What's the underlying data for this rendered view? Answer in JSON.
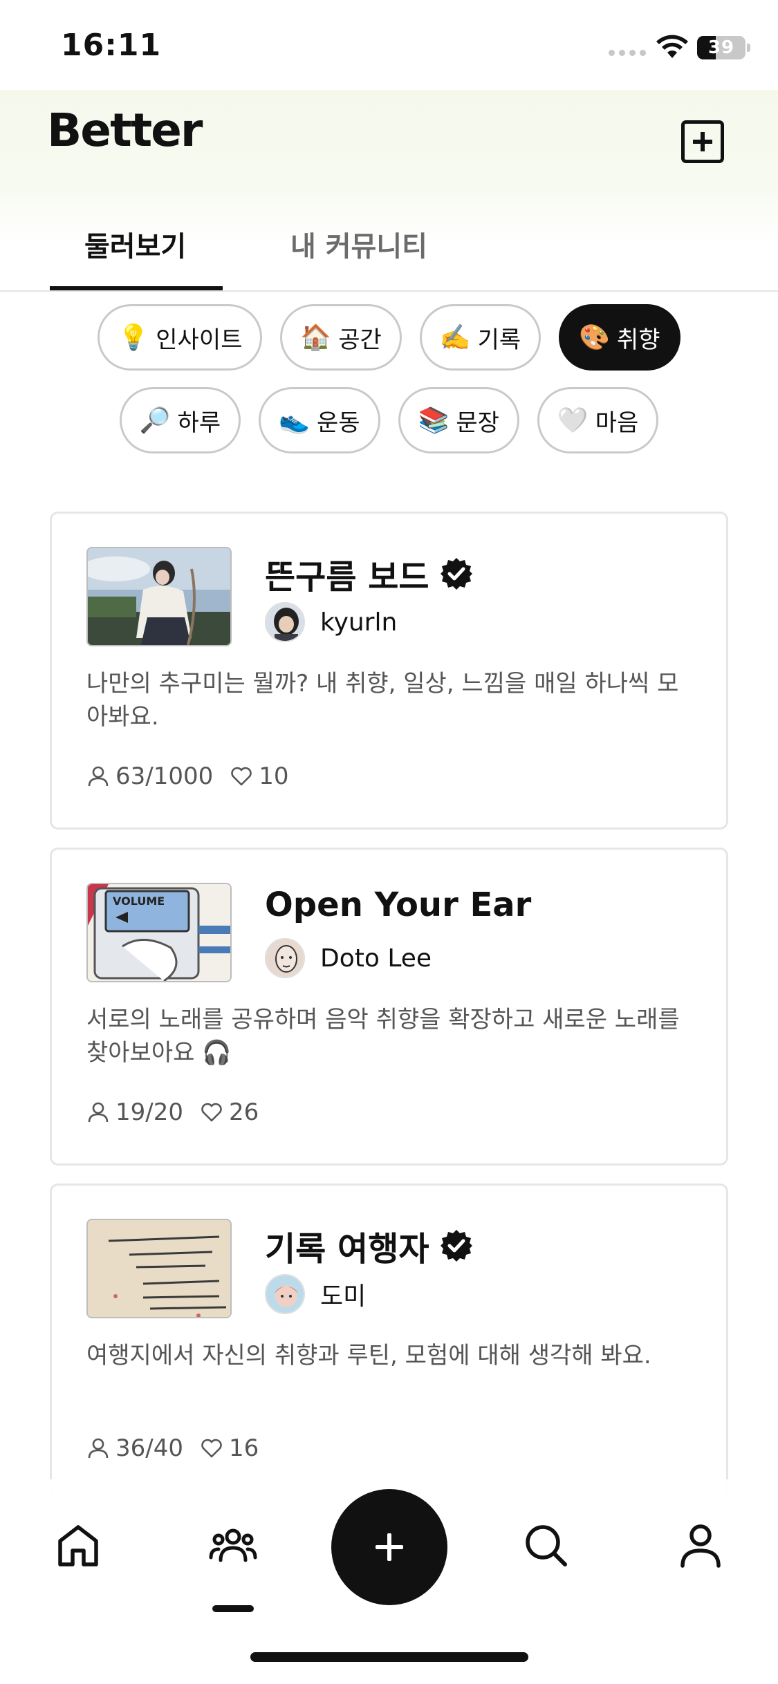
{
  "status_bar": {
    "time": "16:11",
    "battery_level": "39",
    "battery_fraction": 0.39
  },
  "header": {
    "logo": "Better",
    "add_button_icon": "plus-square-icon"
  },
  "tabs": [
    {
      "label": "둘러보기",
      "active": true
    },
    {
      "label": "내 커뮤니티",
      "active": false
    }
  ],
  "categories_row1": [
    {
      "emoji": "💡",
      "label": "인사이트",
      "selected": false
    },
    {
      "emoji": "🏠",
      "label": "공간",
      "selected": false
    },
    {
      "emoji": "✍️",
      "label": "기록",
      "selected": false
    },
    {
      "emoji": "🎨",
      "label": "취향",
      "selected": true
    }
  ],
  "categories_row2": [
    {
      "emoji": "🔎",
      "label": "하루",
      "selected": false
    },
    {
      "emoji": "👟",
      "label": "운동",
      "selected": false
    },
    {
      "emoji": "📚",
      "label": "문장",
      "selected": false
    },
    {
      "emoji": "🤍",
      "label": "마음",
      "selected": false
    }
  ],
  "communities": [
    {
      "title": "뜬구름 보드",
      "verified": true,
      "author": "kyurln",
      "description": "나만의 추구미는 뭘까? 내 취향, 일상, 느낌을 매일 하나씩 모아봐요.",
      "members": "63/1000",
      "likes": "10"
    },
    {
      "title": "Open Your Ear",
      "verified": false,
      "author": "Doto Lee",
      "description": "서로의 노래를 공유하며 음악 취향을 확장하고 새로운 노래를 찾아보아요 🎧",
      "members": "19/20",
      "likes": "26"
    },
    {
      "title": "기록 여행자",
      "verified": true,
      "author": "도미",
      "description": "여행지에서 자신의 취향과 루틴, 모험에 대해 생각해 봐요.",
      "members": "36/40",
      "likes": "16"
    }
  ],
  "bottom_nav": {
    "items": [
      "home-icon",
      "community-icon",
      "create-icon",
      "search-icon",
      "profile-icon"
    ],
    "active": "community-icon"
  },
  "colors": {
    "primary": "#111111",
    "header_tint": "#f5f9ec",
    "chip_border": "#c9c9c9",
    "muted_text": "#555555"
  }
}
